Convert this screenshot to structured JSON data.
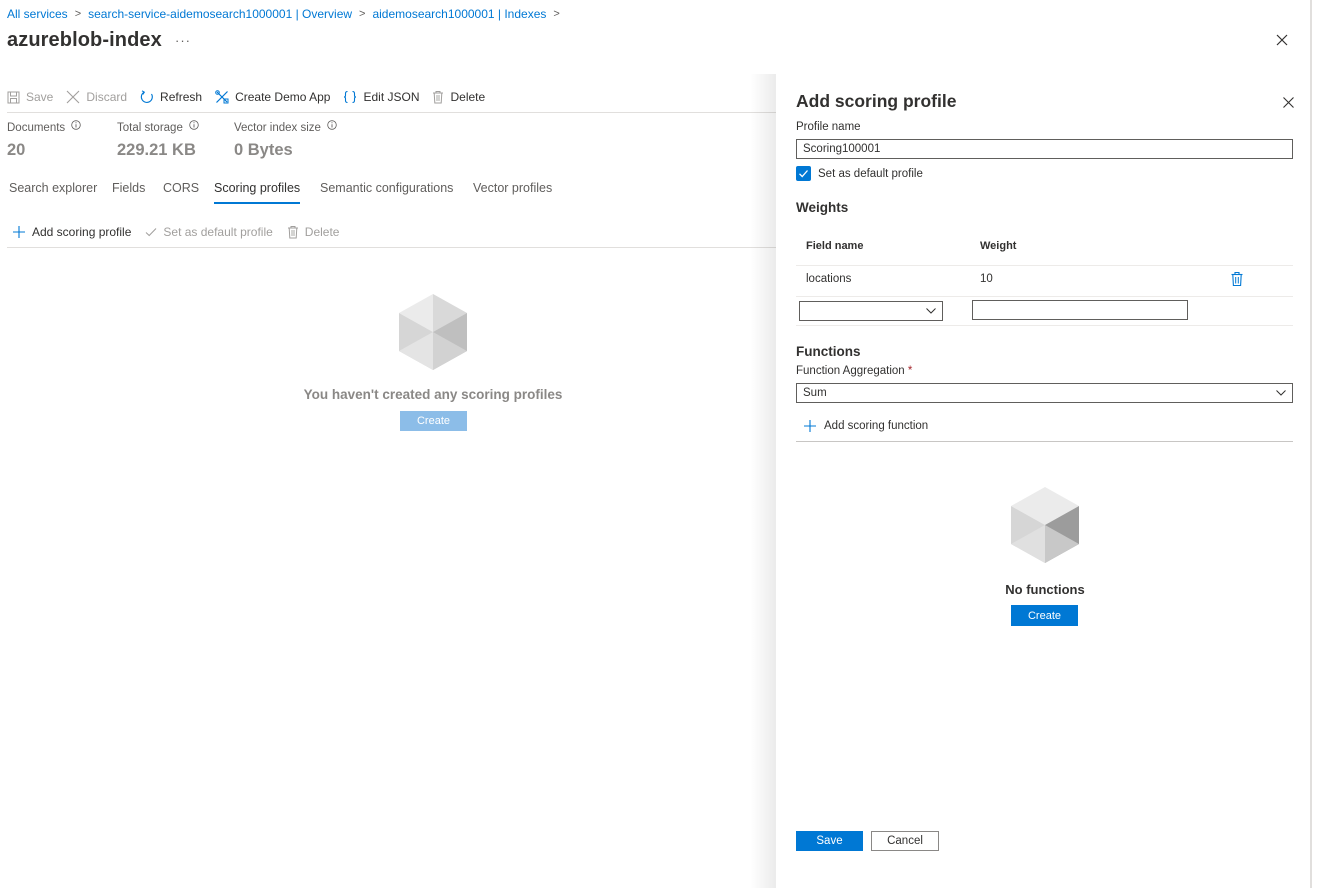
{
  "breadcrumb": {
    "items": [
      "All services",
      "search-service-aidemosearch1000001 | Overview",
      "aidemosearch1000001 | Indexes"
    ]
  },
  "page": {
    "title": "azureblob-index",
    "more": "···"
  },
  "toolbar": {
    "save": "Save",
    "discard": "Discard",
    "refresh": "Refresh",
    "create_demo_app": "Create Demo App",
    "edit_json": "Edit JSON",
    "delete": "Delete"
  },
  "stats": {
    "documents_label": "Documents",
    "documents_value": "20",
    "storage_label": "Total storage",
    "storage_value": "229.21 KB",
    "vector_label": "Vector index size",
    "vector_value": "0 Bytes"
  },
  "tabs": {
    "search_explorer": "Search explorer",
    "fields": "Fields",
    "cors": "CORS",
    "scoring_profiles": "Scoring profiles",
    "semantic": "Semantic configurations",
    "vector": "Vector profiles",
    "active": "Scoring profiles"
  },
  "subtoolbar": {
    "add": "Add scoring profile",
    "set_default": "Set as default profile",
    "delete": "Delete"
  },
  "main_empty": {
    "text": "You haven't created any scoring profiles",
    "create": "Create"
  },
  "panel": {
    "title": "Add scoring profile",
    "profile_name_label": "Profile name",
    "profile_name_value": "Scoring100001",
    "default_checkbox_label": "Set as default profile",
    "default_checked": true,
    "weights_title": "Weights",
    "weights_headers": [
      "Field name",
      "Weight"
    ],
    "weights_rows": [
      {
        "field": "locations",
        "weight": "10"
      }
    ],
    "new_field_value": "",
    "new_weight_value": "",
    "functions_title": "Functions",
    "aggregation_label": "Function Aggregation",
    "aggregation_required": "*",
    "aggregation_value": "Sum",
    "add_function": "Add scoring function",
    "empty_text": "No functions",
    "empty_create": "Create",
    "save": "Save",
    "cancel": "Cancel"
  },
  "colors": {
    "accent": "#0078d4",
    "accent_disabled": "#8cbde8",
    "text": "#323130",
    "muted": "#a19f9d"
  },
  "icons": [
    "chevron-right-icon",
    "more-icon",
    "close-icon",
    "save-icon",
    "discard-icon",
    "refresh-icon",
    "demo-app-icon",
    "json-icon",
    "delete-icon",
    "info-icon",
    "add-icon",
    "check-icon",
    "cube-icon",
    "chevron-down-icon"
  ]
}
